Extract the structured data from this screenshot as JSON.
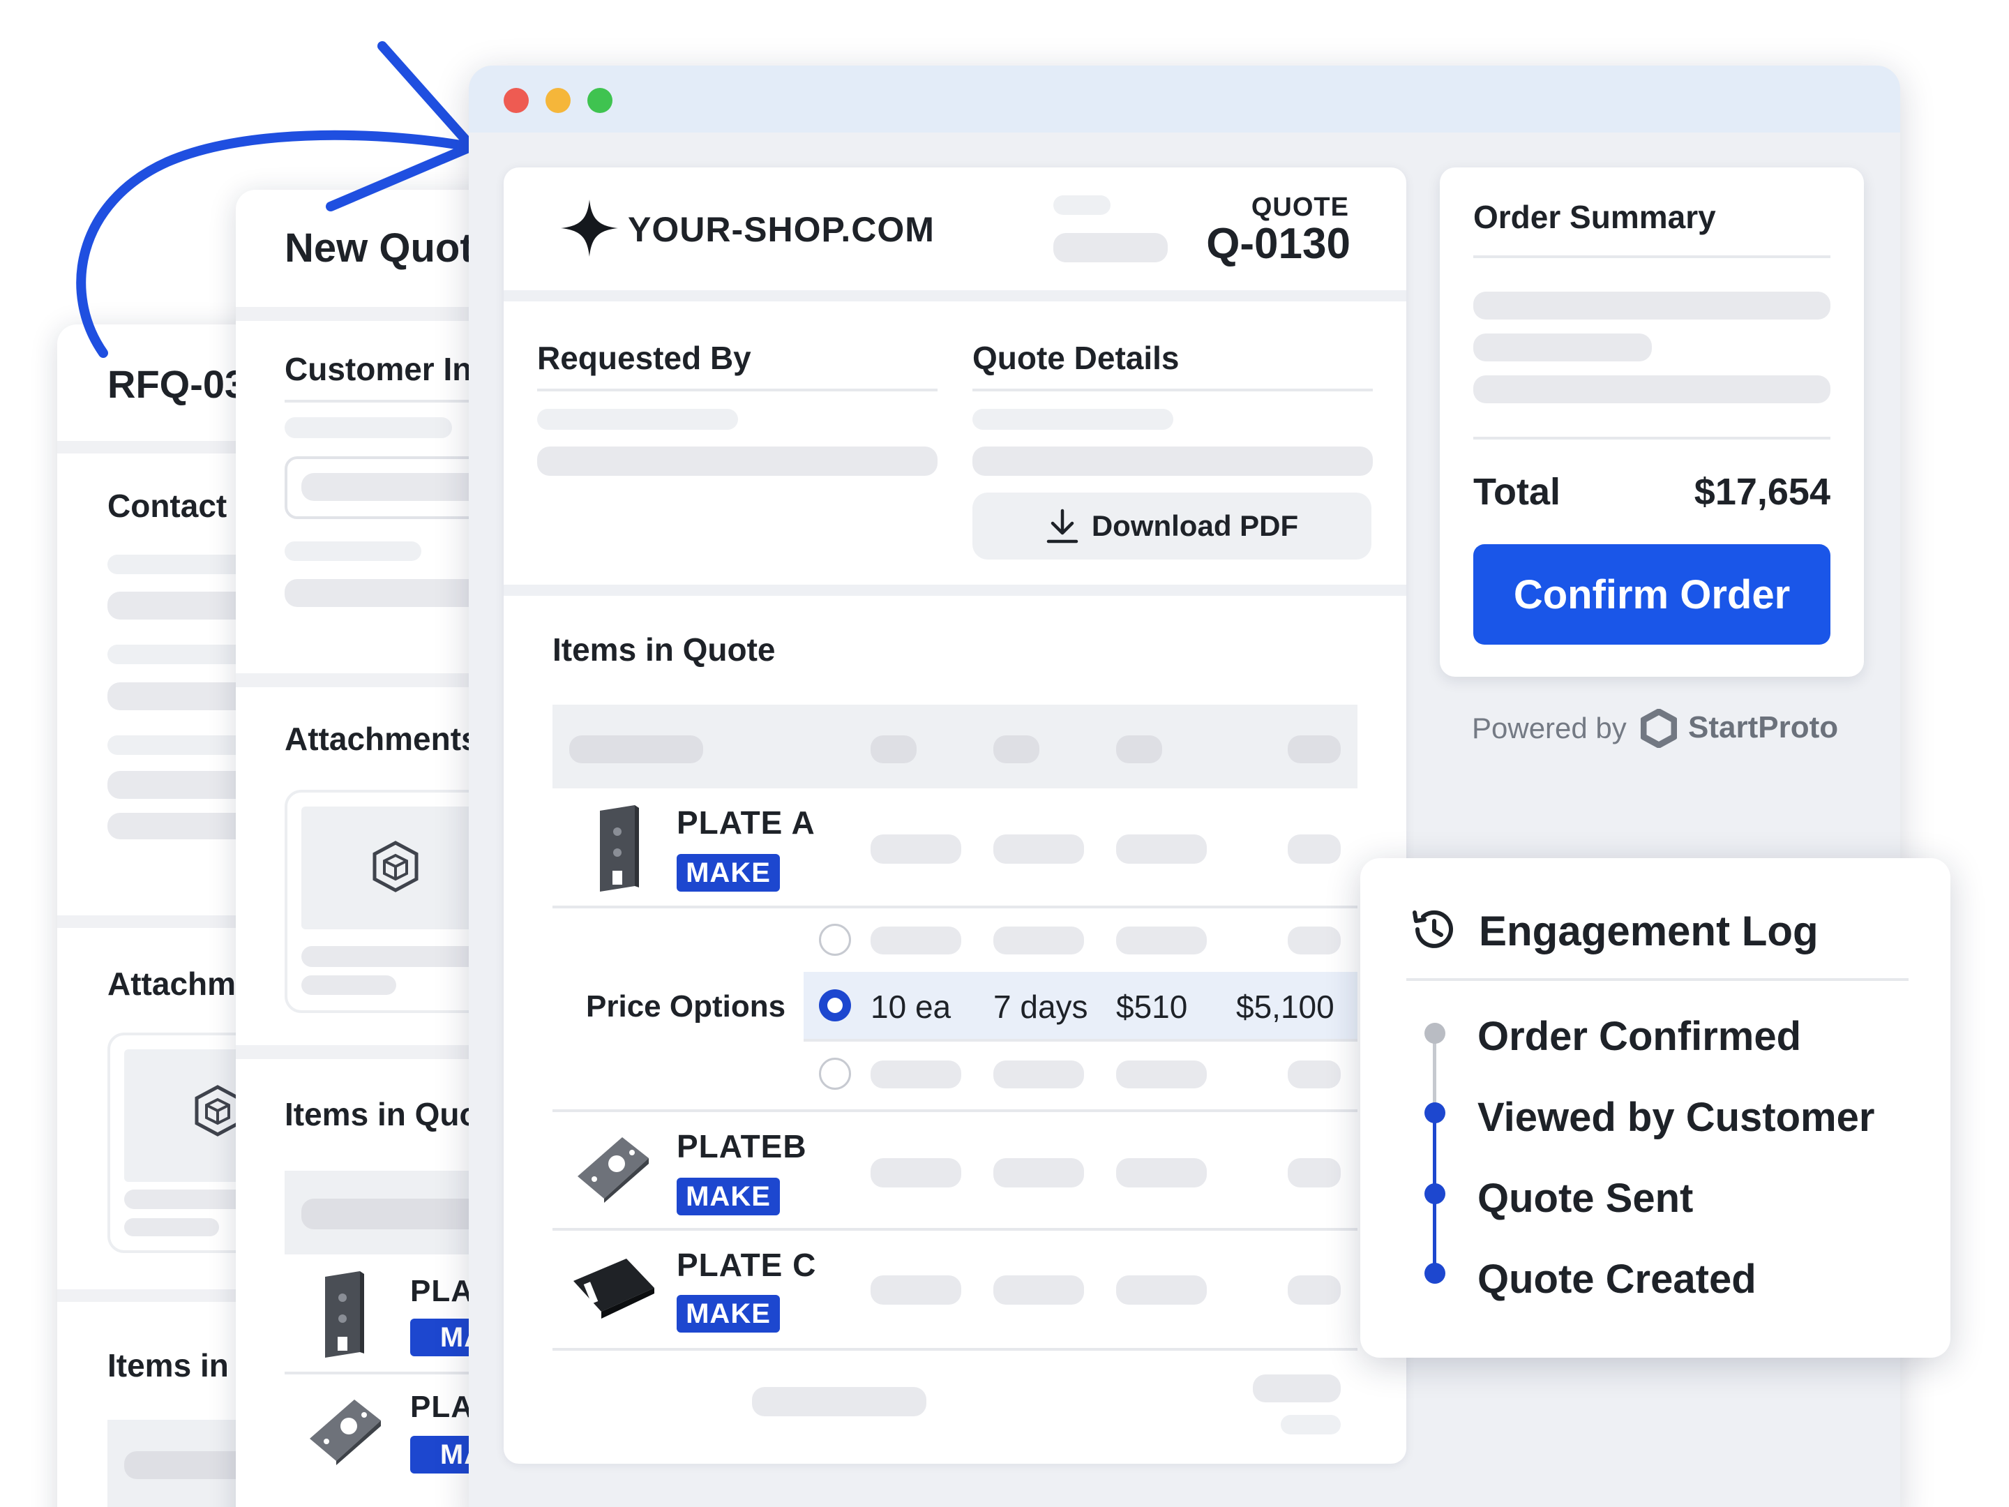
{
  "back_panel_2": {
    "title": "RFQ-03",
    "contact_label": "Contact",
    "attachments_label": "Attachm",
    "items_label": "Items in"
  },
  "back_panel_1": {
    "title": "New Quot",
    "customer_label": "Customer In",
    "attachments_label": "Attachments",
    "items_label": "Items in Quo",
    "items": [
      {
        "name": "PLA",
        "tag": "MA"
      },
      {
        "name": "PLA",
        "tag": "MA"
      }
    ]
  },
  "quote": {
    "brand": "YOUR-SHOP.COM",
    "label": "QUOTE",
    "number": "Q-0130",
    "requested_by_label": "Requested By",
    "quote_details_label": "Quote Details",
    "download_pdf": "Download PDF",
    "items_heading": "Items in Quote",
    "price_options_label": "Price Options",
    "selected_option": {
      "qty": "10 ea",
      "lead": "7 days",
      "unit": "$510",
      "total": "$5,100"
    },
    "items": [
      {
        "name": "PLATE A",
        "tag": "MAKE"
      },
      {
        "name": "PLATEB",
        "tag": "MAKE"
      },
      {
        "name": "PLATE C",
        "tag": "MAKE"
      }
    ]
  },
  "order_summary": {
    "title": "Order Summary",
    "total_label": "Total",
    "total_value": "$17,654",
    "confirm_button": "Confirm Order",
    "powered_by": "Powered by",
    "powered_brand": "StartProto"
  },
  "engagement_log": {
    "title": "Engagement Log",
    "events": [
      "Order Confirmed",
      "Viewed by Customer",
      "Quote Sent",
      "Quote Created"
    ]
  },
  "colors": {
    "accent": "#1d47cf",
    "button": "#1a56e8",
    "window_bar": "#e3ecf8",
    "canvas": "#eef0f4"
  },
  "icons": [
    "arrow-annotation-icon",
    "sparkle-logo-icon",
    "download-icon",
    "cube-icon",
    "history-icon",
    "hexagon-logo-icon",
    "plate-part-icon"
  ]
}
